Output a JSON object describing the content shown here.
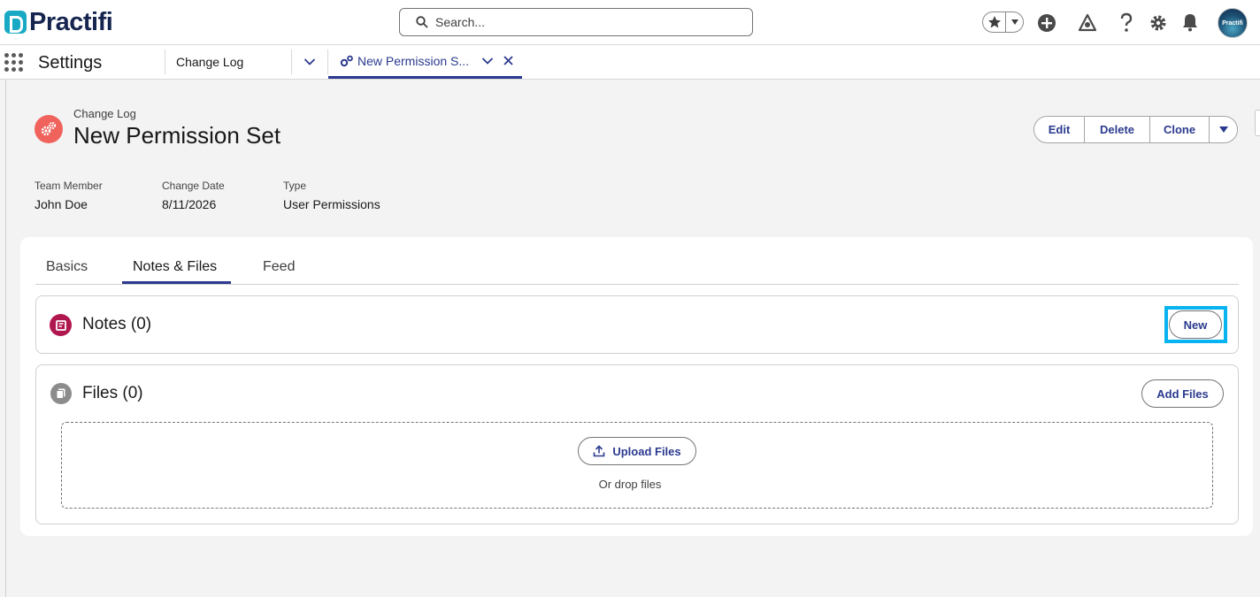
{
  "header": {
    "logo_text": "Practifi",
    "search_placeholder": "Search...",
    "avatar_text": "Practifi",
    "icons": [
      "star-icon",
      "chevron-down-icon",
      "add-icon",
      "trailhead-icon",
      "help-icon",
      "gear-icon",
      "bell-icon"
    ]
  },
  "nav": {
    "app_name": "Settings",
    "tabs": [
      {
        "label": "Change Log",
        "active": false
      },
      {
        "label": "New Permission S...",
        "active": true
      }
    ]
  },
  "record": {
    "type_label": "Change Log",
    "title": "New Permission Set",
    "actions": [
      "Edit",
      "Delete",
      "Clone"
    ],
    "fields": [
      {
        "label": "Team Member",
        "value": "John Doe"
      },
      {
        "label": "Change Date",
        "value": "8/11/2026"
      },
      {
        "label": "Type",
        "value": "User Permissions"
      }
    ]
  },
  "tabs": [
    {
      "label": "Basics",
      "active": false
    },
    {
      "label": "Notes & Files",
      "active": true
    },
    {
      "label": "Feed",
      "active": false
    }
  ],
  "notes": {
    "title": "Notes (0)",
    "new_label": "New"
  },
  "files": {
    "title": "Files (0)",
    "add_label": "Add Files",
    "upload_label": "Upload Files",
    "drop_text": "Or drop files"
  },
  "colors": {
    "brand_navy": "#16254f",
    "brand_teal": "#18a9c4",
    "link_blue": "#2b3a8f",
    "record_icon": "#f0635d",
    "notes_icon": "#b0174f",
    "highlight": "#08b3ef"
  }
}
